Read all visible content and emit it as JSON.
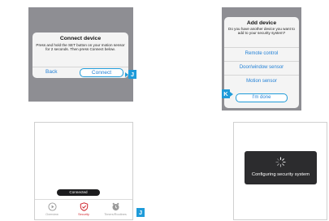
{
  "connect_dialog": {
    "title": "Connect device",
    "body": "Press and hold the SET button on your motion sensor for 2 seconds. Then press Connect below.",
    "back_label": "Back",
    "connect_label": "Connect",
    "callout": "J"
  },
  "add_device_dialog": {
    "title": "Add device",
    "body": "Do you have another device you want to add to your security system?",
    "options": [
      "Remote control",
      "Door/window sensor",
      "Motion sensor"
    ],
    "done_label": "I'm done",
    "callout": "K"
  },
  "home_screen": {
    "toast": "Connected",
    "tabs": [
      {
        "label": "Overview",
        "icon": "play-circle-icon"
      },
      {
        "label": "Security",
        "icon": "shield-check-icon"
      },
      {
        "label": "Timers/Routines",
        "icon": "clock-icon"
      }
    ],
    "callout": "J"
  },
  "configuring_screen": {
    "message": "Configuring security system",
    "icon": "spinner-icon"
  },
  "colors": {
    "accent": "#1f9bd9",
    "link": "#1f7fd6",
    "overlay": "#8e8e93",
    "security_red": "#d0272f",
    "hud": "#2c2c2e"
  }
}
